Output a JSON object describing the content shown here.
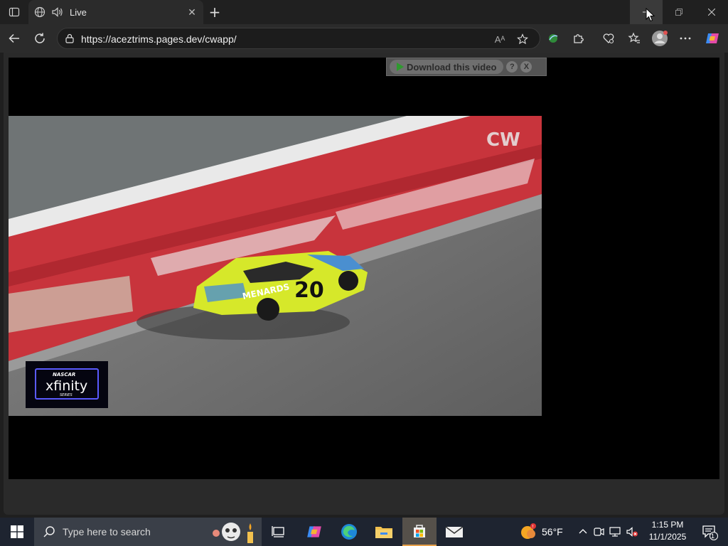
{
  "browser": {
    "tab_title": "Live",
    "address_url": "https://aceztrims.pages.dev/cwapp/",
    "reader_label": "Aᴬ"
  },
  "player": {
    "download_label": "Download this video",
    "help_label": "?",
    "close_label": "X",
    "video_overlay": {
      "network_logo": "CW",
      "series_logo_top": "NASCAR",
      "series_logo_main": "xfinity",
      "series_logo_sub": "SERIES",
      "car_number": "20",
      "car_sponsor": "MENARDS"
    }
  },
  "taskbar": {
    "search_placeholder": "Type here to search",
    "weather": "56°F",
    "time": "1:15 PM",
    "date": "11/1/2025",
    "notification_count": "1"
  },
  "colors": {
    "accent": "#e8a14a",
    "download_play": "#2e9a2e"
  }
}
